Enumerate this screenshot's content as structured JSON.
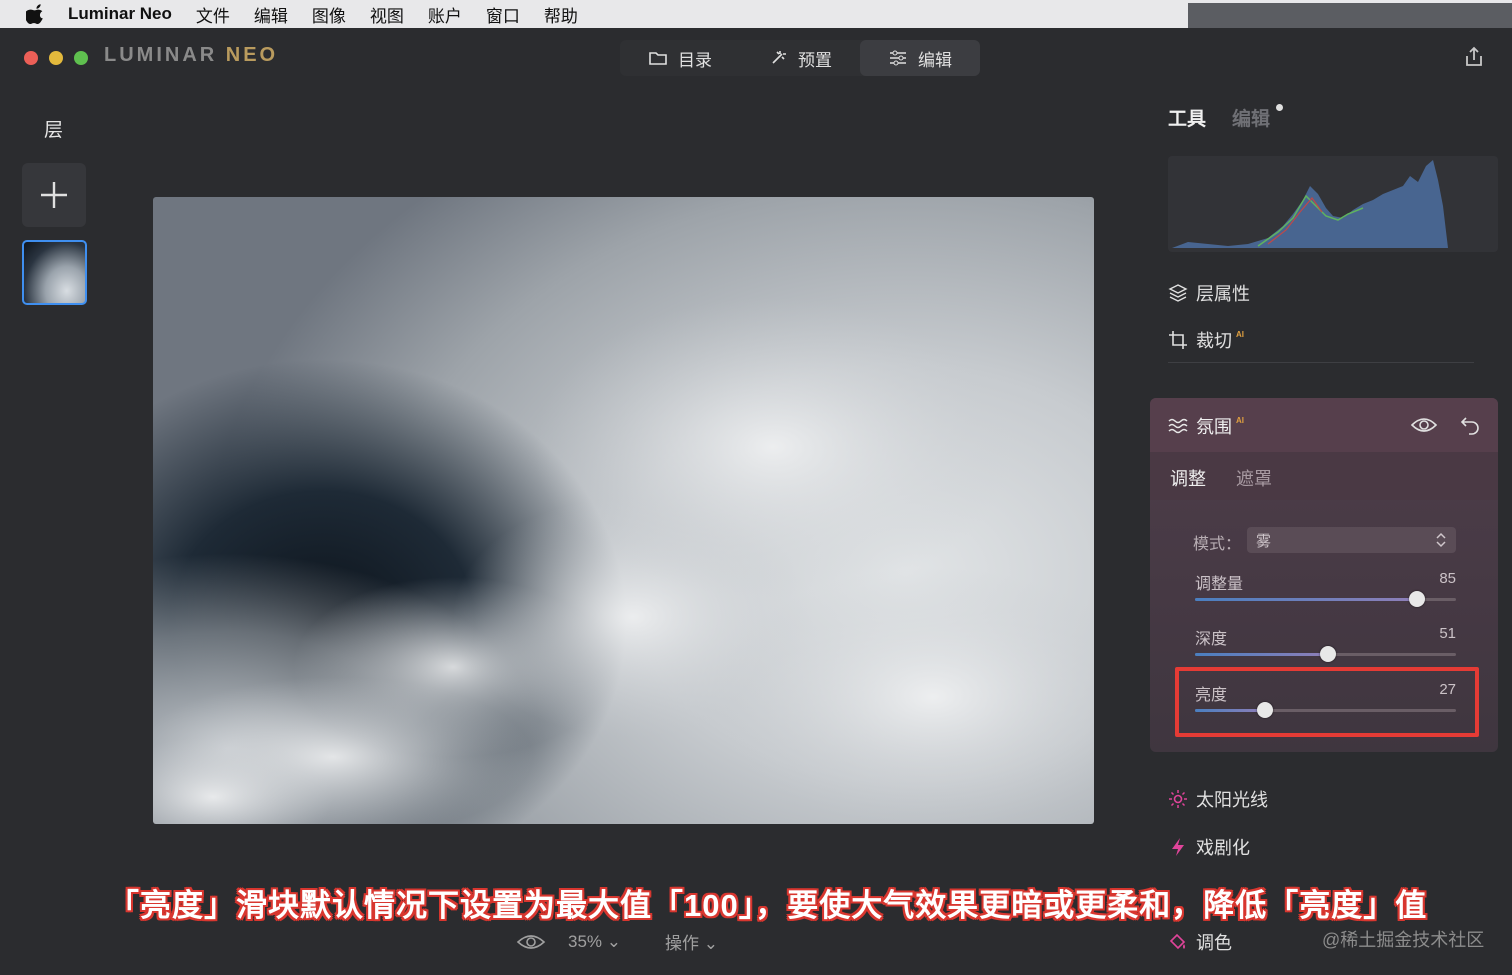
{
  "menubar": {
    "app_name": "Luminar Neo",
    "items": [
      "文件",
      "编辑",
      "图像",
      "视图",
      "账户",
      "窗口",
      "帮助"
    ]
  },
  "titlebar": {
    "logo_main": "LUMINAR ",
    "logo_neo": "NEO",
    "nav": [
      {
        "label": "目录",
        "icon": "folder-icon"
      },
      {
        "label": "预置",
        "icon": "magic-wand-icon"
      },
      {
        "label": "编辑",
        "icon": "sliders-icon",
        "active": true
      }
    ]
  },
  "left": {
    "title": "层"
  },
  "right": {
    "tab_tools": "工具",
    "tab_edits": "编辑",
    "tools": [
      {
        "label": "层属性",
        "icon": "layers-icon"
      },
      {
        "label": "裁切",
        "icon": "crop-icon",
        "ai": "AI"
      }
    ],
    "atmosphere": {
      "title": "氛围",
      "ai": "AI",
      "subtabs": [
        "调整",
        "遮罩"
      ],
      "mode_label": "模式：",
      "mode_value": "雾",
      "sliders": [
        {
          "label": "调整量",
          "value": "85",
          "fraction": 0.85
        },
        {
          "label": "深度",
          "value": "51",
          "fraction": 0.51
        },
        {
          "label": "亮度",
          "value": "27",
          "fraction": 0.27
        }
      ]
    },
    "tools_below": [
      {
        "label": "太阳光线",
        "icon": "sun-rays-icon",
        "color": "#e0449a"
      },
      {
        "label": "戏剧化",
        "icon": "lightning-icon",
        "color": "#e0449a"
      },
      {
        "label": "调色",
        "icon": "paint-bucket-icon",
        "color": "#e0449a"
      }
    ]
  },
  "bottom": {
    "zoom": "35%",
    "actions": "操作"
  },
  "caption": "「亮度」滑块默认情况下设置为最大值「100」，要使大气效果更暗或更柔和，降低「亮度」值",
  "watermark": "@稀土掘金技术社区",
  "colors": {
    "accent_blue": "#3f8ff0",
    "highlight_red": "#e53b35",
    "tool_pink": "#e0449a"
  }
}
